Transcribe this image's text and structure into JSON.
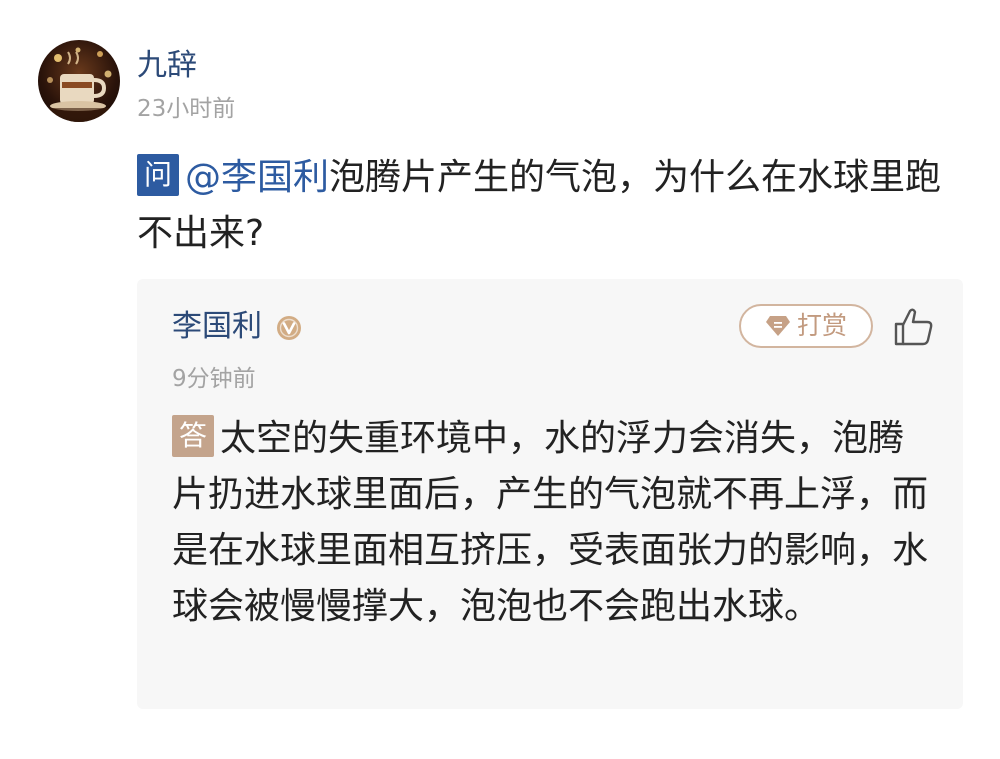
{
  "post": {
    "user_name": "九辞",
    "time": "23小时前",
    "avatar_icon": "coffee-cup-avatar"
  },
  "question": {
    "badge": "问",
    "mention": "@李国利",
    "text": "泡腾片产生的气泡，为什么在水球里跑不出来?"
  },
  "reply": {
    "user_name": "李国利",
    "verified_icon": "verified-v-icon",
    "tip_icon": "gem-icon",
    "tip_label": "打赏",
    "like_icon": "thumbs-up-icon",
    "time": "9分钟前",
    "badge": "答",
    "text": "太空的失重环境中，水的浮力会消失，泡腾片扔进水球里面后，产生的气泡就不再上浮，而是在水球里面相互挤压，受表面张力的影响，水球会被慢慢撑大，泡泡也不会跑出水球。"
  },
  "colors": {
    "link_blue": "#2c4a78",
    "question_badge": "#2d5ba1",
    "answer_badge": "#c4a48c",
    "tip_border": "#d2b59f",
    "reply_bg": "#f7f7f7"
  }
}
